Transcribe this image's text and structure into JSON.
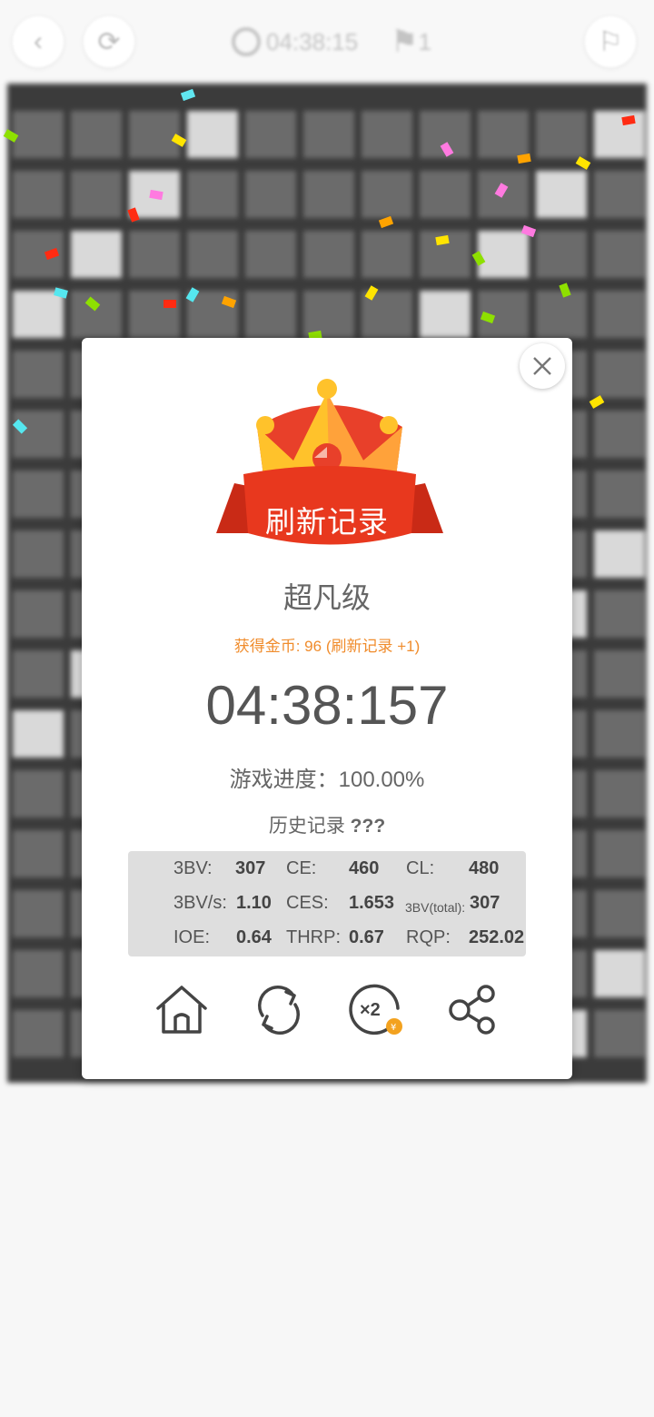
{
  "topbar": {
    "back_icon": "chevron-left-icon",
    "restart_icon": "refresh-icon",
    "timer": "04:38:15",
    "flags": "1",
    "hint_icon": "flag-outline-icon"
  },
  "dialog": {
    "ribbon_text": "刷新记录",
    "level": "超凡级",
    "coins": "获得金币: 96 (刷新记录 +1)",
    "time": "04:38:157",
    "progress": "游戏进度：100.00%",
    "history_label": "历史记录",
    "history_value": "???",
    "stats": [
      {
        "label": "3BV:",
        "value": "307"
      },
      {
        "label": "CE:",
        "value": "460"
      },
      {
        "label": "CL:",
        "value": "480"
      },
      {
        "label": "3BV/s:",
        "value": "1.10"
      },
      {
        "label": "CES:",
        "value": "1.653"
      },
      {
        "label": "3BV(total):",
        "value": "307"
      },
      {
        "label": "IOE:",
        "value": "0.64"
      },
      {
        "label": "THRP:",
        "value": "0.67"
      },
      {
        "label": "RQP:",
        "value": "252.02"
      }
    ],
    "actions": [
      "home-icon",
      "replay-icon",
      "double-coins-icon",
      "share-icon"
    ]
  },
  "colors": {
    "ribbon": "#e8381e",
    "crown": "#ffc22b",
    "coins_text": "#f08c2c",
    "panel_bg": "#dedede"
  }
}
